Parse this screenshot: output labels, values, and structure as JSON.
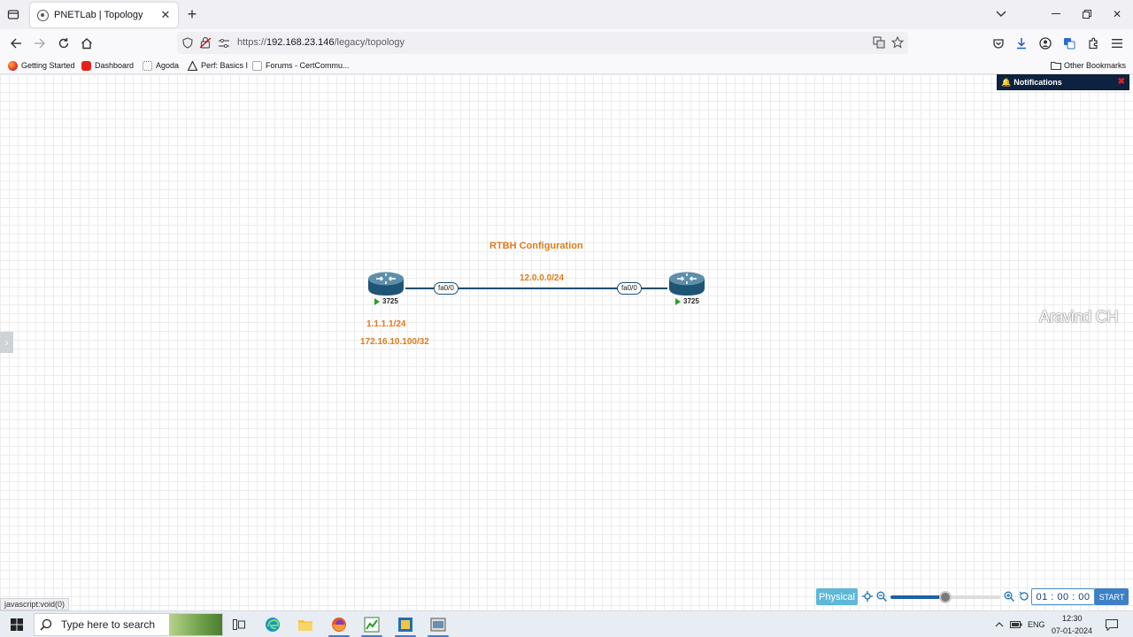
{
  "browser": {
    "tab_title": "PNETLab | Topology",
    "url_prefix": "https://",
    "url_host": "192.168.23.146",
    "url_path": "/legacy/topology",
    "bookmarks": [
      {
        "label": "Getting Started"
      },
      {
        "label": "Dashboard"
      },
      {
        "label": "Agoda"
      },
      {
        "label": "Perf: Basics I"
      },
      {
        "label": "Forums - CertCommu..."
      }
    ],
    "other_bookmarks": "Other Bookmarks"
  },
  "workspace": {
    "notifications_label": "Notifications",
    "lab_title": "RTBH Configuration",
    "link_subnet": "12.0.0.0/24",
    "left_router": {
      "model": "3725",
      "interface": "fa0/0",
      "loopback_1": "1.1.1.1/24",
      "loopback_2": "172.16.10.100/32",
      "status": "running"
    },
    "right_router": {
      "model": "3725",
      "interface": "fa0/0",
      "status": "running"
    },
    "watermark": "Aravind CH",
    "status_text": "javascript:void(0)"
  },
  "controls": {
    "physical_label": "Physical",
    "zoom_level": 0.5,
    "timer_text": "01 : 00 : 00",
    "start_label": "START"
  },
  "taskbar": {
    "search_placeholder": "Type here to search",
    "language": "ENG",
    "time": "12:30",
    "date": "07-01-2024"
  },
  "colors": {
    "label_orange": "#e07b1a",
    "link_blue": "#1f4f73",
    "notif_bg": "#0d2240",
    "physical_bg": "#5fb8d8",
    "start_bg": "#3d80c5"
  }
}
